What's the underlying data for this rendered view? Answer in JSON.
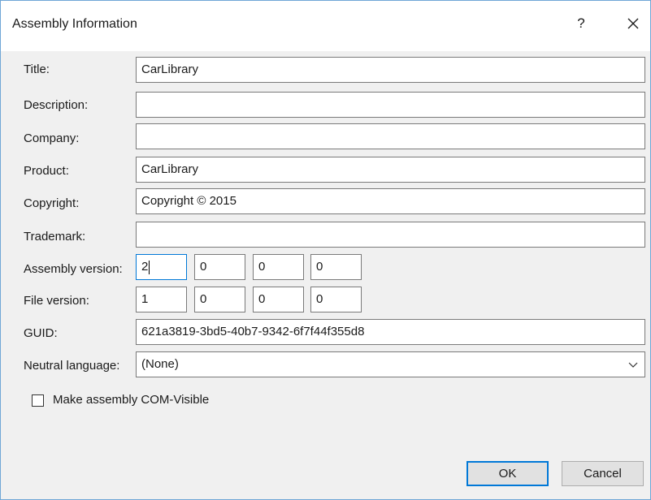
{
  "window": {
    "title": "Assembly Information",
    "help_label": "?",
    "close_icon": "close-icon"
  },
  "fields": {
    "title": {
      "label": "Title:",
      "value": "CarLibrary"
    },
    "description": {
      "label": "Description:",
      "value": ""
    },
    "company": {
      "label": "Company:",
      "value": ""
    },
    "product": {
      "label": "Product:",
      "value": "CarLibrary"
    },
    "copyright": {
      "label": "Copyright:",
      "value": "Copyright ©  2015"
    },
    "trademark": {
      "label": "Trademark:",
      "value": ""
    },
    "assembly_version": {
      "label": "Assembly version:",
      "parts": [
        "2",
        "0",
        "0",
        "0"
      ]
    },
    "file_version": {
      "label": "File version:",
      "parts": [
        "1",
        "0",
        "0",
        "0"
      ]
    },
    "guid": {
      "label": "GUID:",
      "value": "621a3819-3bd5-40b7-9342-6f7f44f355d8"
    },
    "neutral_language": {
      "label": "Neutral language:",
      "value": "(None)",
      "arrow_icon": "chevron-down-icon"
    }
  },
  "com_visible": {
    "label": "Make assembly COM-Visible",
    "checked": false
  },
  "buttons": {
    "ok": "OK",
    "cancel": "Cancel"
  },
  "colors": {
    "accent": "#0078d7",
    "window_border": "#6fa6d6",
    "background": "#f0f0f0"
  }
}
